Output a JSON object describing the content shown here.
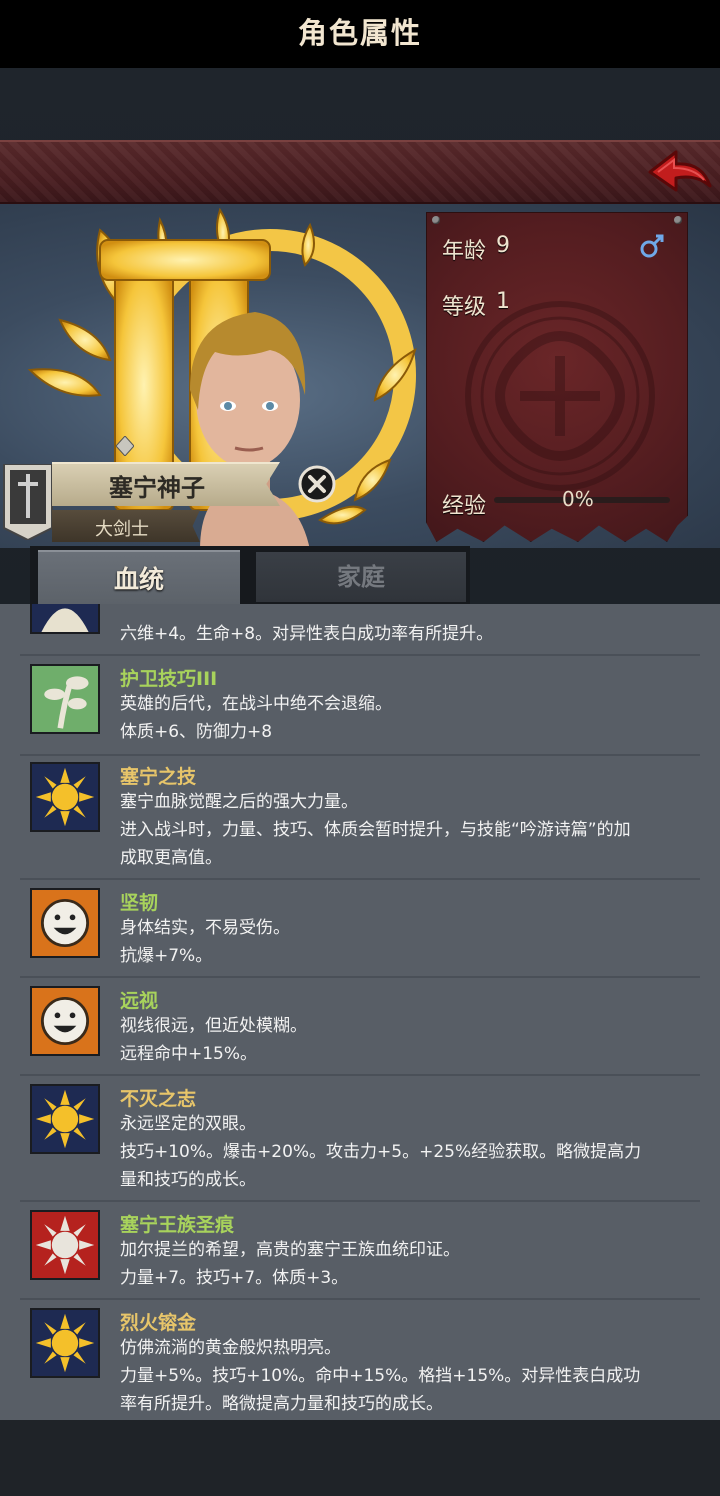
{
  "header": {
    "title": "角色属性"
  },
  "hero": {
    "name": "塞宁神子",
    "title": "大剑士"
  },
  "stats": {
    "age_label": "年龄",
    "age_value": "9",
    "level_label": "等级",
    "level_value": "1",
    "exp_label": "经验",
    "exp_value": "0%",
    "exp_fraction": 0.0,
    "gender": "male"
  },
  "tabs": [
    {
      "label": "血统",
      "active": true
    },
    {
      "label": "家庭",
      "active": false
    }
  ],
  "traits": [
    {
      "icon": "pale-crest-icon",
      "name": "",
      "lines": [
        "六维+4。生命+8。对异性表白成功率有所提升。"
      ]
    },
    {
      "icon": "sprout-icon",
      "name": "护卫技巧III",
      "name_color": "green",
      "lines": [
        "英雄的后代，在战斗中绝不会退缩。",
        "体质+6、防御力+8"
      ]
    },
    {
      "icon": "sun-icon",
      "name": "塞宁之技",
      "name_color": "gold",
      "lines": [
        "塞宁血脉觉醒之后的强大力量。",
        "进入战斗时，力量、技巧、体质会暂时提升，与技能“吟游诗篇”的加",
        "成取更高值。"
      ]
    },
    {
      "icon": "smiley-icon",
      "name": "坚韧",
      "name_color": "green",
      "lines": [
        "身体结实，不易受伤。",
        "抗爆+7%。"
      ]
    },
    {
      "icon": "smiley-icon",
      "name": "远视",
      "name_color": "green",
      "lines": [
        "视线很远，但近处模糊。",
        "远程命中+15%。"
      ]
    },
    {
      "icon": "sun-icon",
      "name": "不灭之志",
      "name_color": "gold",
      "lines": [
        "永远坚定的双眼。",
        "技巧+10%。爆击+20%。攻击力+5。+25%经验获取。略微提高力",
        "量和技巧的成长。"
      ]
    },
    {
      "icon": "silver-sun-icon",
      "name": "塞宁王族圣痕",
      "name_color": "green",
      "lines": [
        "加尔提兰的希望，高贵的塞宁王族血统印证。",
        "力量+7。技巧+7。体质+3。"
      ]
    },
    {
      "icon": "sun-icon",
      "name": "烈火镕金",
      "name_color": "gold",
      "lines": [
        "仿佛流淌的黄金般炽热明亮。",
        "力量+5%。技巧+10%。命中+15%。格挡+15%。对异性表白成功",
        "率有所提升。略微提高力量和技巧的成长。"
      ]
    }
  ],
  "colors": {
    "accent_green": "#a8d35c",
    "accent_gold": "#e7c56a",
    "header_red": "#4a1e21"
  }
}
